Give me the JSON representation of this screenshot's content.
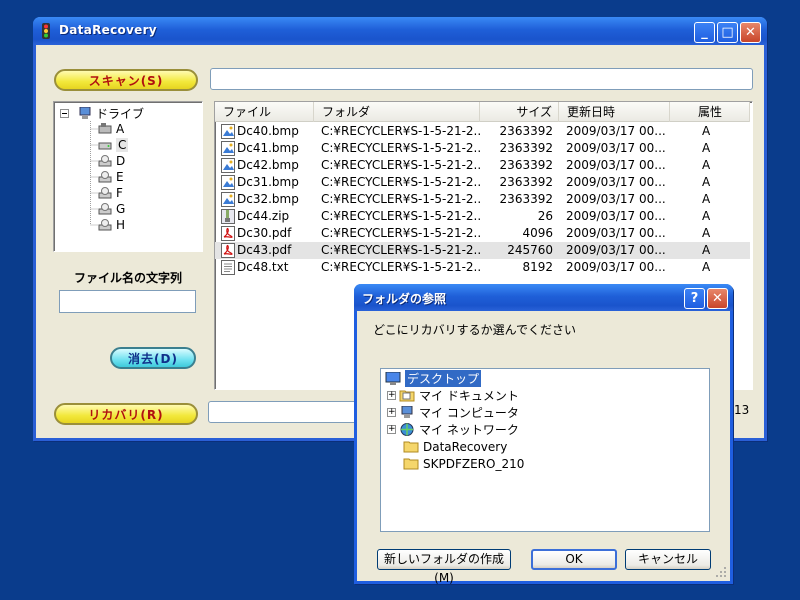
{
  "window": {
    "title": "DataRecovery"
  },
  "title_buttons": {
    "minimize": "_",
    "maximize": "□",
    "close": "✕"
  },
  "scan_button": "スキャン(S)",
  "recover_button": "リカバリ(R)",
  "clear_button": "消去(D)",
  "filename_filter_label": "ファイル名の文字列",
  "filename_filter_value": "",
  "path_field_value": "",
  "status_count": "13",
  "drive_tree": {
    "root": "ドライブ",
    "drives": [
      "A",
      "C",
      "D",
      "E",
      "F",
      "G",
      "H"
    ],
    "selected": "C"
  },
  "file_list": {
    "columns": [
      "ファイル",
      "フォルダ",
      "サイズ",
      "更新日時",
      "属性"
    ],
    "rows": [
      {
        "name": "Dc40.bmp",
        "folder": "C:¥RECYCLER¥S-1-5-21-2...",
        "size": "2363392",
        "date": "2009/03/17 00...",
        "attr": "A",
        "icon": "bitmap-icon"
      },
      {
        "name": "Dc41.bmp",
        "folder": "C:¥RECYCLER¥S-1-5-21-2...",
        "size": "2363392",
        "date": "2009/03/17 00...",
        "attr": "A",
        "icon": "bitmap-icon"
      },
      {
        "name": "Dc42.bmp",
        "folder": "C:¥RECYCLER¥S-1-5-21-2...",
        "size": "2363392",
        "date": "2009/03/17 00...",
        "attr": "A",
        "icon": "bitmap-icon"
      },
      {
        "name": "Dc31.bmp",
        "folder": "C:¥RECYCLER¥S-1-5-21-2...",
        "size": "2363392",
        "date": "2009/03/17 00...",
        "attr": "A",
        "icon": "bitmap-icon"
      },
      {
        "name": "Dc32.bmp",
        "folder": "C:¥RECYCLER¥S-1-5-21-2...",
        "size": "2363392",
        "date": "2009/03/17 00...",
        "attr": "A",
        "icon": "bitmap-icon"
      },
      {
        "name": "Dc44.zip",
        "folder": "C:¥RECYCLER¥S-1-5-21-2...",
        "size": "26",
        "date": "2009/03/17 00...",
        "attr": "A",
        "icon": "zip-icon"
      },
      {
        "name": "Dc30.pdf",
        "folder": "C:¥RECYCLER¥S-1-5-21-2...",
        "size": "4096",
        "date": "2009/03/17 00...",
        "attr": "A",
        "icon": "pdf-icon"
      },
      {
        "name": "Dc43.pdf",
        "folder": "C:¥RECYCLER¥S-1-5-21-2...",
        "size": "245760",
        "date": "2009/03/17 00...",
        "attr": "A",
        "icon": "pdf-icon",
        "selected": true
      },
      {
        "name": "Dc48.txt",
        "folder": "C:¥RECYCLER¥S-1-5-21-2...",
        "size": "8192",
        "date": "2009/03/17 00...",
        "attr": "A",
        "icon": "text-file-icon"
      }
    ]
  },
  "dialog": {
    "title": "フォルダの参照",
    "help_button": "?",
    "close_button": "✕",
    "prompt": "どこにリカバリするか選んでください",
    "tree": [
      {
        "label": "デスクトップ",
        "icon": "desktop-icon",
        "selected": true
      },
      {
        "label": "マイ ドキュメント",
        "icon": "my-documents-icon",
        "expandable": true
      },
      {
        "label": "マイ コンピュータ",
        "icon": "my-computer-icon",
        "expandable": true
      },
      {
        "label": "マイ ネットワーク",
        "icon": "network-icon",
        "expandable": true
      },
      {
        "label": "DataRecovery",
        "icon": "folder-icon"
      },
      {
        "label": "SKPDFZERO_210",
        "icon": "folder-icon"
      }
    ],
    "new_folder_button": "新しいフォルダの作成(M)",
    "ok_button": "OK",
    "cancel_button": "キャンセル"
  },
  "colors": {
    "desktop": "#0a3c8c",
    "title_bar": "#1f5fd8",
    "window_face": "#ece9d8",
    "yellow_button": "#f2e83a",
    "cyan_button": "#6fe1f0",
    "button_text_red": "#b01010"
  }
}
